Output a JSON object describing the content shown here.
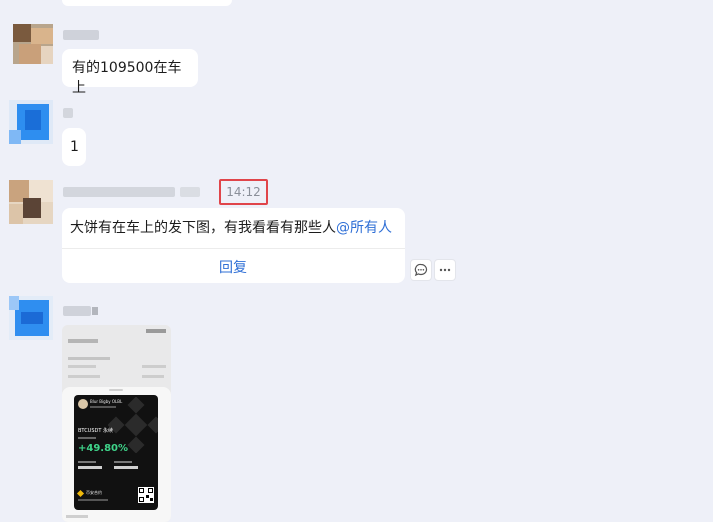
{
  "messages": [
    {
      "text": "有的109500在车上"
    },
    {
      "text": "1"
    },
    {
      "timestamp": "14:12",
      "text": "大饼有在车上的发下图，有我看看有那些人",
      "mention": "@所有人",
      "reply_label": "回复"
    },
    {
      "image": {
        "card_name": "Blur Bigby OLBL",
        "pair": "BTCUSDT 永续",
        "pnl": "+49.80%",
        "footer": "币安合约"
      }
    }
  ],
  "actions": {
    "comment_icon": "comment-icon",
    "more_icon": "more-icon"
  },
  "colors": {
    "accent": "#2f6fd6",
    "highlight": "#e0454a",
    "gain": "#3fd48a"
  }
}
